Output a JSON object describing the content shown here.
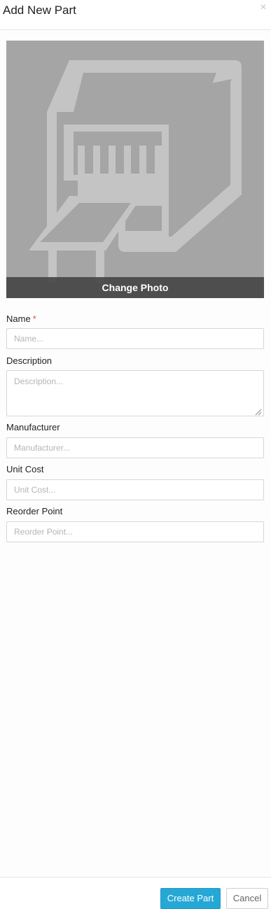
{
  "dialog": {
    "title": "Add New Part",
    "close_symbol": "×"
  },
  "photo": {
    "change_label": "Change Photo",
    "placeholder_icon": "part-placeholder-icon",
    "background": "#a5a5a5"
  },
  "fields": {
    "name": {
      "label": "Name",
      "required_mark": "*",
      "placeholder": "Name...",
      "value": ""
    },
    "description": {
      "label": "Description",
      "placeholder": "Description...",
      "value": ""
    },
    "manufacturer": {
      "label": "Manufacturer",
      "placeholder": "Manufacturer...",
      "value": ""
    },
    "unit_cost": {
      "label": "Unit Cost",
      "placeholder": "Unit Cost...",
      "value": ""
    },
    "reorder_point": {
      "label": "Reorder Point",
      "placeholder": "Reorder Point...",
      "value": ""
    }
  },
  "footer": {
    "create_label": "Create Part",
    "cancel_label": "Cancel"
  },
  "colors": {
    "primary": "#26a8d6",
    "required": "#d9534f"
  }
}
